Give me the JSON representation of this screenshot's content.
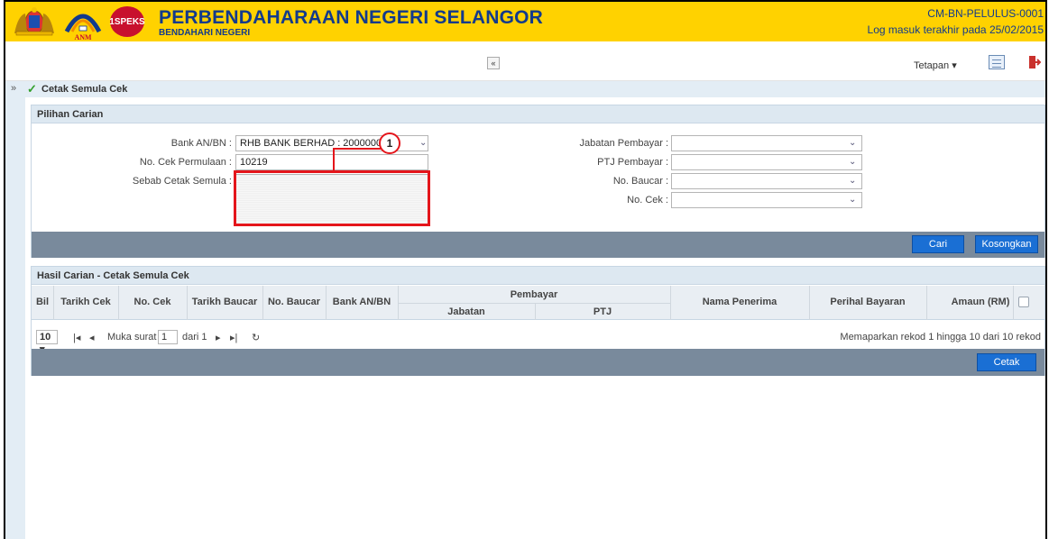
{
  "header": {
    "title": "PERBENDAHARAAN NEGERI SELANGOR",
    "subtitle": "BENDAHARI NEGERI",
    "user_id": "CM-BN-PELULUS-0001",
    "last_login": "Log masuk terakhir pada 25/02/2015",
    "logo_anm_text": "ANM",
    "logo_speks_text": "1SPEKS"
  },
  "toolbar": {
    "collapse_symbol": "«",
    "settings_label": "Tetapan ▾"
  },
  "breadcrumb": {
    "expand_symbol": "»",
    "title": "Cetak Semula Cek"
  },
  "search_panel": {
    "title": "Pilihan Carian",
    "bank_label": "Bank AN/BN :",
    "bank_value": "RHB BANK BERHAD : 200000000",
    "cheque_start_label": "No. Cek Permulaan :",
    "cheque_start_value": "10219",
    "reprint_reason_label": "Sebab Cetak Semula :",
    "payer_dept_label": "Jabatan Pembayar :",
    "payer_ptj_label": "PTJ Pembayar :",
    "voucher_no_label": "No. Baucar :",
    "cheque_no_label": "No. Cek :",
    "callout_number": "1",
    "search_button": "Cari",
    "clear_button": "Kosongkan"
  },
  "results_panel": {
    "title": "Hasil Carian - Cetak Semula Cek",
    "columns": {
      "bil": "Bil",
      "cheque_date": "Tarikh Cek",
      "cheque_no": "No. Cek",
      "voucher_date": "Tarikh Baucar",
      "voucher_no": "No. Baucar",
      "bank": "Bank AN/BN",
      "payer": "Pembayar",
      "payer_dept": "Jabatan",
      "payer_ptj": "PTJ",
      "recipient": "Nama Penerima",
      "description": "Perihal Bayaran",
      "amount": "Amaun (RM)"
    },
    "pager": {
      "page_size": "10 ▾",
      "first": "|◂",
      "prev": "◂",
      "page_label": "Muka surat",
      "page_value": "1",
      "of_pages": "dari 1",
      "next": "▸",
      "last": "▸|",
      "refresh": "↻",
      "summary": "Memaparkan rekod 1 hingga 10 dari 10 rekod"
    },
    "print_button": "Cetak"
  },
  "colors": {
    "header_bg": "#ffd200",
    "header_text": "#123a8c",
    "button_blue": "#1a6fd4",
    "bar_gray": "#798a9c",
    "highlight_red": "#e4151b"
  }
}
